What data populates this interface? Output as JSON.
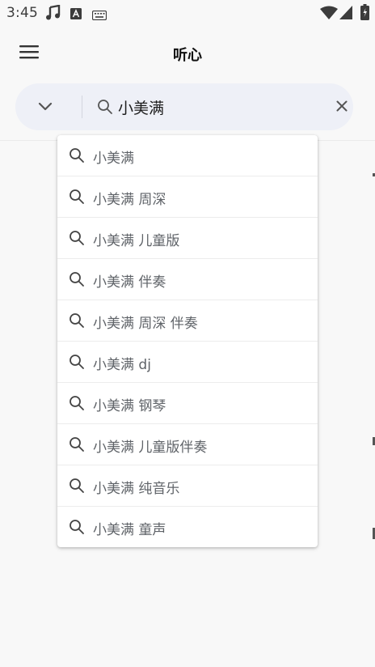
{
  "status_bar": {
    "time": "3:45",
    "icons": [
      "music-note-icon",
      "text-a-icon",
      "keyboard-icon",
      "wifi-icon",
      "cell-signal-icon",
      "battery-icon"
    ]
  },
  "app_bar": {
    "title": "听心",
    "menu_icon": "menu-icon"
  },
  "search": {
    "value": "小美满",
    "placeholder": "",
    "dropdown_icon": "chevron-down-icon",
    "search_icon": "search-icon",
    "clear_icon": "close-icon"
  },
  "suggestions": [
    {
      "label": "小美满"
    },
    {
      "label": "小美满 周深"
    },
    {
      "label": "小美满 儿童版"
    },
    {
      "label": "小美满 伴奏"
    },
    {
      "label": "小美满 周深 伴奏"
    },
    {
      "label": "小美满 dj"
    },
    {
      "label": "小美满 钢琴"
    },
    {
      "label": "小美满 儿童版伴奏"
    },
    {
      "label": "小美满 纯音乐"
    },
    {
      "label": "小美满 童声"
    }
  ],
  "colors": {
    "background": "#f8f8f8",
    "search_bar_bg": "#eef0f7",
    "suggestion_text": "#5f6368",
    "title_text": "#111111"
  }
}
